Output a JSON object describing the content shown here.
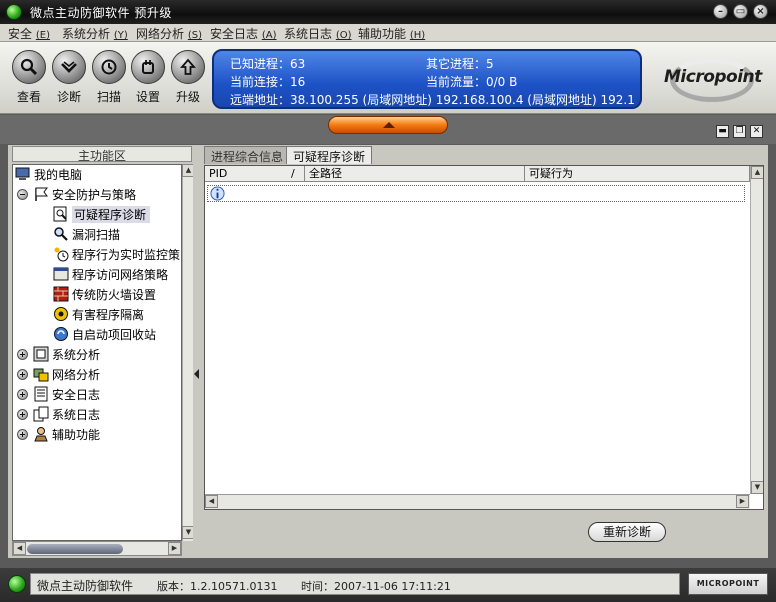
{
  "window": {
    "title": "微点主动防御软件   预升级",
    "buttons": {
      "minimize": "–",
      "restore": "▭",
      "close": "×"
    }
  },
  "menu": [
    {
      "label": "安全",
      "accel": "(E)"
    },
    {
      "label": "系统分析",
      "accel": "(Y)"
    },
    {
      "label": "网络分析",
      "accel": "(S)"
    },
    {
      "label": "安全日志",
      "accel": "(A)"
    },
    {
      "label": "系统日志",
      "accel": "(O)"
    },
    {
      "label": "辅助功能",
      "accel": "(H)"
    }
  ],
  "toolbar": [
    {
      "label": "查看",
      "icon": "magnifier-icon"
    },
    {
      "label": "诊断",
      "icon": "diagnose-icon"
    },
    {
      "label": "扫描",
      "icon": "scan-icon"
    },
    {
      "label": "设置",
      "icon": "settings-hand-icon"
    },
    {
      "label": "升级",
      "icon": "upgrade-arrow-icon"
    }
  ],
  "info": {
    "known_processes": "已知进程：63",
    "other_processes": "其它进程：5",
    "current_connections": "当前连接：16",
    "current_traffic": "当前流量：0/0 B",
    "remote_address_label": "远端地址：",
    "remote_address_value": "38.100.255 (局域网地址)    192.168.100.4 (局域网地址)    192.1"
  },
  "logo": {
    "text": "Micropoint"
  },
  "left_panel": {
    "header": "主功能区",
    "tree": {
      "root": "我的电脑",
      "security_group": "安全防护与策略",
      "security_children": [
        "可疑程序诊断",
        "漏洞扫描",
        "程序行为实时监控策",
        "程序访问网络策略",
        "传统防火墙设置",
        "有害程序隔离",
        "自启动项回收站"
      ],
      "groups": [
        "系统分析",
        "网络分析",
        "安全日志",
        "系统日志",
        "辅助功能"
      ]
    }
  },
  "right_panel": {
    "tabs": [
      "进程综合信息",
      "可疑程序诊断"
    ],
    "active_tab": 1,
    "columns": [
      "PID",
      "全路径",
      "可疑行为"
    ],
    "sort_indicator": "/",
    "rediagnose_button": "重新诊断"
  },
  "status": {
    "app_name": "微点主动防御软件",
    "version": "版本：1.2.10571.0131",
    "time": "时间：2007-11-06 17:11:21",
    "logo": "MICROPOINT"
  },
  "colors": {
    "info_panel": "#1d52c6",
    "collapse_button": "#f47a12",
    "title_bar": "#0e0e0e"
  }
}
